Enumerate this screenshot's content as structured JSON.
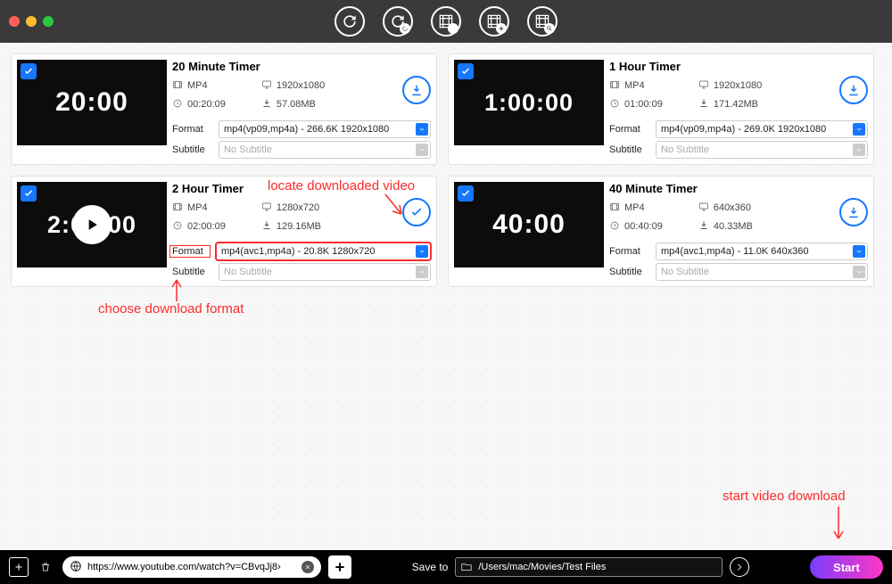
{
  "toolbar": {
    "icons": [
      "refresh",
      "refresh-alt",
      "film-download",
      "film-add",
      "film-search"
    ]
  },
  "cards": [
    {
      "title": "20 Minute Timer",
      "thumb_text": "20:00",
      "thumb_font": "30px",
      "checked": true,
      "play_overlay": false,
      "completed": false,
      "codec": "MP4",
      "resolution": "1920x1080",
      "duration": "00:20:09",
      "size": "57.08MB",
      "format_value": "mp4(vp09,mp4a) - 266.6K 1920x1080",
      "subtitle_value": "No Subtitle",
      "format_hl": false,
      "labels": {
        "format": "Format",
        "subtitle": "Subtitle"
      }
    },
    {
      "title": "1 Hour Timer",
      "thumb_text": "1:00:00",
      "thumb_font": "27px",
      "checked": true,
      "play_overlay": false,
      "completed": false,
      "codec": "MP4",
      "resolution": "1920x1080",
      "duration": "01:00:09",
      "size": "171.42MB",
      "format_value": "mp4(vp09,mp4a) - 269.0K 1920x1080",
      "subtitle_value": "No Subtitle",
      "format_hl": false,
      "labels": {
        "format": "Format",
        "subtitle": "Subtitle"
      }
    },
    {
      "title": "2 Hour Timer",
      "thumb_text": "2:00:00",
      "thumb_font": "27px",
      "checked": true,
      "play_overlay": true,
      "completed": true,
      "codec": "MP4",
      "resolution": "1280x720",
      "duration": "02:00:09",
      "size": "129.16MB",
      "format_value": "mp4(avc1,mp4a) - 20.8K 1280x720",
      "subtitle_value": "No Subtitle",
      "format_hl": true,
      "labels": {
        "format": "Format",
        "subtitle": "Subtitle"
      }
    },
    {
      "title": "40 Minute Timer",
      "thumb_text": "40:00",
      "thumb_font": "30px",
      "checked": true,
      "play_overlay": false,
      "completed": false,
      "codec": "MP4",
      "resolution": "640x360",
      "duration": "00:40:09",
      "size": "40.33MB",
      "format_value": "mp4(avc1,mp4a) - 11.0K 640x360",
      "subtitle_value": "No Subtitle",
      "format_hl": false,
      "labels": {
        "format": "Format",
        "subtitle": "Subtitle"
      }
    }
  ],
  "annotations": {
    "locate": "locate downloaded video",
    "choose": "choose download format",
    "start": "start video download"
  },
  "bottom": {
    "url": "https://www.youtube.com/watch?v=CBvqJj8›",
    "saveto_label": "Save to",
    "saveto_path": "/Users/mac/Movies/Test Files",
    "start_label": "Start"
  }
}
